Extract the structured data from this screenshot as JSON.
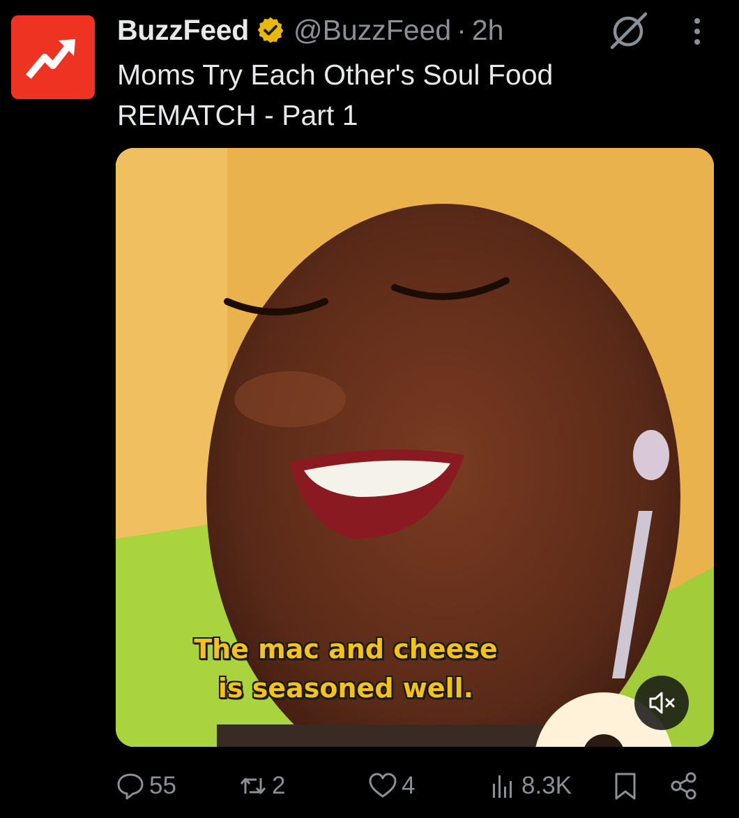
{
  "author": {
    "name": "BuzzFeed",
    "handle": "@BuzzFeed",
    "separator": "·",
    "time": "2h",
    "avatar_color": "#ee3322",
    "verified_color": "#e8b90c"
  },
  "post": {
    "text": "Moms Try Each Other's Soul Food REMATCH - Part 1"
  },
  "media": {
    "caption_line1": "The mac and cheese",
    "caption_line2": "is seasoned well.",
    "caption_color": "#f6c21a",
    "mute_icon": "speaker-muted-icon"
  },
  "actions": {
    "replies": "55",
    "reposts": "2",
    "likes": "4",
    "views": "8.3K"
  },
  "icons": {
    "grok": "grok-icon",
    "more": "more-vertical-icon",
    "reply": "reply-icon",
    "repost": "repost-icon",
    "like": "heart-icon",
    "views": "views-chart-icon",
    "bookmark": "bookmark-icon",
    "share": "share-icon"
  }
}
